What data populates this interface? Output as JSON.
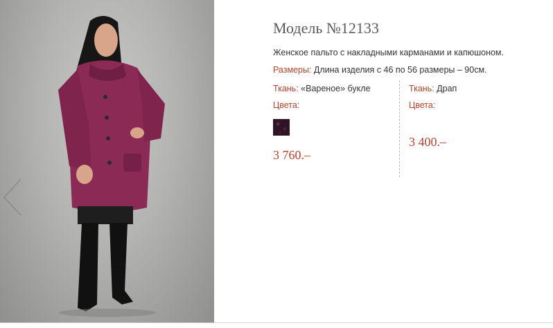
{
  "product": {
    "title": "Модель №12133",
    "description": "Женское пальто с накладными карманами и капюшоном.",
    "sizes_label": "Размеры:",
    "sizes_value": "Длина изделия с 46 по 56 размеры – 90см."
  },
  "variants": [
    {
      "fabric_label": "Ткань:",
      "fabric_value": "«Вареное» букле",
      "colors_label": "Цвета:",
      "swatch_color": "#2e1426",
      "price": "3 760.–"
    },
    {
      "fabric_label": "Ткань:",
      "fabric_value": "Драп",
      "colors_label": "Цвета:",
      "price": "3 400.–"
    }
  ],
  "icons": {
    "prev": "chevron-left-icon"
  },
  "colors": {
    "accent": "#b7412a",
    "title": "#5a5a5a",
    "coat": "#8a2a55"
  }
}
